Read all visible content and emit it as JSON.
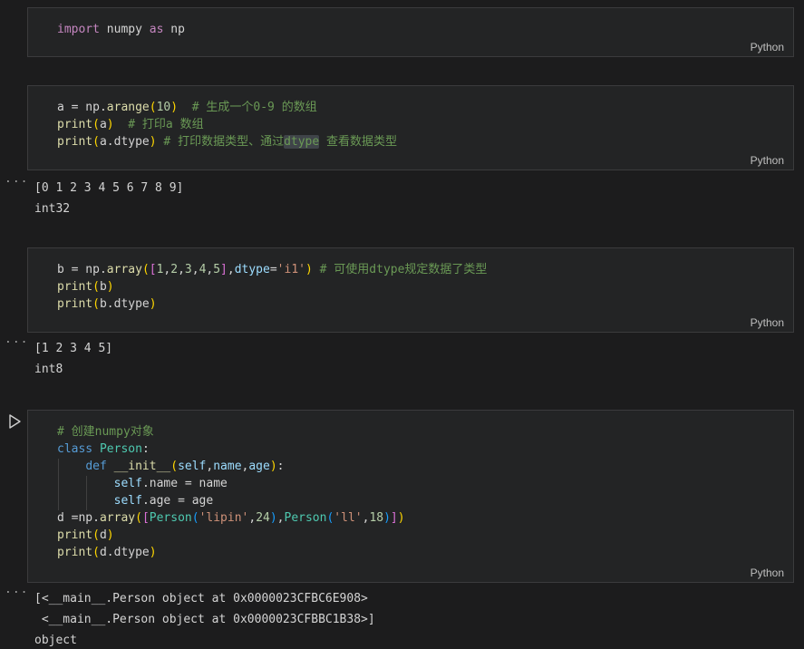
{
  "language_label": "Python",
  "output_ellipsis": "...",
  "theme": {
    "page_bg": "#1c1c1d",
    "cell_bg": "#232425",
    "cell_border": "#3b3b3d",
    "keyword_pink": "#c586c0",
    "keyword_blue": "#569cd6",
    "function_yellow": "#dcdcaa",
    "class_teal": "#4ec9b0",
    "param_blue": "#9cdcfe",
    "string_orange": "#ce9178",
    "number_green": "#b5cea8",
    "comment_green": "#6a9955",
    "bracket1_gold": "#ffd700",
    "bracket2_pink": "#da70d6",
    "bracket3_blue": "#179fff"
  },
  "cells": [
    {
      "lines": [
        [
          [
            "import",
            "kw"
          ],
          [
            " numpy ",
            "txt"
          ],
          [
            "as",
            "kw"
          ],
          [
            " np",
            "txt"
          ]
        ]
      ]
    },
    {
      "lines": [
        [
          [
            "a = np.",
            "txt"
          ],
          [
            "arange",
            "fn"
          ],
          [
            "(",
            "b1"
          ],
          [
            "10",
            "num"
          ],
          [
            ")",
            "b1"
          ],
          [
            "  ",
            "txt"
          ],
          [
            "# 生成一个0-9 的数组",
            "com"
          ]
        ],
        [
          [
            "print",
            "fn"
          ],
          [
            "(",
            "b1"
          ],
          [
            "a",
            "txt"
          ],
          [
            ")",
            "b1"
          ],
          [
            "  ",
            "txt"
          ],
          [
            "# 打印a 数组",
            "com"
          ]
        ],
        [
          [
            "print",
            "fn"
          ],
          [
            "(",
            "b1"
          ],
          [
            "a.dtype",
            "txt"
          ],
          [
            ")",
            "b1"
          ],
          [
            " ",
            "txt"
          ],
          [
            "# 打印数据类型、通过",
            "com"
          ],
          [
            "dtype",
            "comhl"
          ],
          [
            " 查看数据类型",
            "com"
          ]
        ]
      ]
    },
    {
      "lines": [
        [
          [
            "b = np.",
            "txt"
          ],
          [
            "array",
            "fn"
          ],
          [
            "(",
            "b1"
          ],
          [
            "[",
            "b2"
          ],
          [
            "1",
            "num"
          ],
          [
            ",",
            "txt"
          ],
          [
            "2",
            "num"
          ],
          [
            ",",
            "txt"
          ],
          [
            "3",
            "num"
          ],
          [
            ",",
            "txt"
          ],
          [
            "4",
            "num"
          ],
          [
            ",",
            "txt"
          ],
          [
            "5",
            "num"
          ],
          [
            "]",
            "b2"
          ],
          [
            ",",
            "txt"
          ],
          [
            "dtype",
            "param"
          ],
          [
            "=",
            "txt"
          ],
          [
            "'i1'",
            "str"
          ],
          [
            ")",
            "b1"
          ],
          [
            " ",
            "txt"
          ],
          [
            "# 可使用dtype规定数据了类型",
            "com"
          ]
        ],
        [
          [
            "print",
            "fn"
          ],
          [
            "(",
            "b1"
          ],
          [
            "b",
            "txt"
          ],
          [
            ")",
            "b1"
          ]
        ],
        [
          [
            "print",
            "fn"
          ],
          [
            "(",
            "b1"
          ],
          [
            "b.dtype",
            "txt"
          ],
          [
            ")",
            "b1"
          ]
        ]
      ]
    },
    {
      "lines": [
        [
          [
            "# 创建numpy对象",
            "com"
          ]
        ],
        [
          [
            "class",
            "kw2"
          ],
          [
            " ",
            "txt"
          ],
          [
            "Person",
            "cls"
          ],
          [
            ":",
            "txt"
          ]
        ],
        [
          [
            "    ",
            "txt"
          ],
          [
            "def",
            "kw2"
          ],
          [
            " ",
            "txt"
          ],
          [
            "__init__",
            "fn"
          ],
          [
            "(",
            "b1"
          ],
          [
            "self",
            "param"
          ],
          [
            ",",
            "txt"
          ],
          [
            "name",
            "param"
          ],
          [
            ",",
            "txt"
          ],
          [
            "age",
            "param"
          ],
          [
            ")",
            "b1"
          ],
          [
            ":",
            "txt"
          ]
        ],
        [
          [
            "        ",
            "txt"
          ],
          [
            "self",
            "param"
          ],
          [
            ".name = name",
            "txt"
          ]
        ],
        [
          [
            "        ",
            "txt"
          ],
          [
            "self",
            "param"
          ],
          [
            ".age = age",
            "txt"
          ]
        ],
        [
          [
            "d =np.",
            "txt"
          ],
          [
            "array",
            "fn"
          ],
          [
            "(",
            "b1"
          ],
          [
            "[",
            "b2"
          ],
          [
            "Person",
            "cls"
          ],
          [
            "(",
            "b3"
          ],
          [
            "'lipin'",
            "str"
          ],
          [
            ",",
            "txt"
          ],
          [
            "24",
            "num"
          ],
          [
            ")",
            "b3"
          ],
          [
            ",",
            "txt"
          ],
          [
            "Person",
            "cls"
          ],
          [
            "(",
            "b3"
          ],
          [
            "'ll'",
            "str"
          ],
          [
            ",",
            "txt"
          ],
          [
            "18",
            "num"
          ],
          [
            ")",
            "b3"
          ],
          [
            "]",
            "b2"
          ],
          [
            ")",
            "b1"
          ]
        ],
        [
          [
            "print",
            "fn"
          ],
          [
            "(",
            "b1"
          ],
          [
            "d",
            "txt"
          ],
          [
            ")",
            "b1"
          ]
        ],
        [
          [
            "print",
            "fn"
          ],
          [
            "(",
            "b1"
          ],
          [
            "d.dtype",
            "txt"
          ],
          [
            ")",
            "b1"
          ]
        ]
      ]
    }
  ],
  "outputs": [
    {
      "lines": [
        "[0 1 2 3 4 5 6 7 8 9]",
        "int32"
      ]
    },
    {
      "lines": [
        "[1 2 3 4 5]",
        "int8"
      ]
    },
    {
      "lines": [
        "[<__main__.Person object at 0x0000023CFBC6E908>",
        " <__main__.Person object at 0x0000023CFBBC1B38>]",
        "object"
      ]
    }
  ]
}
